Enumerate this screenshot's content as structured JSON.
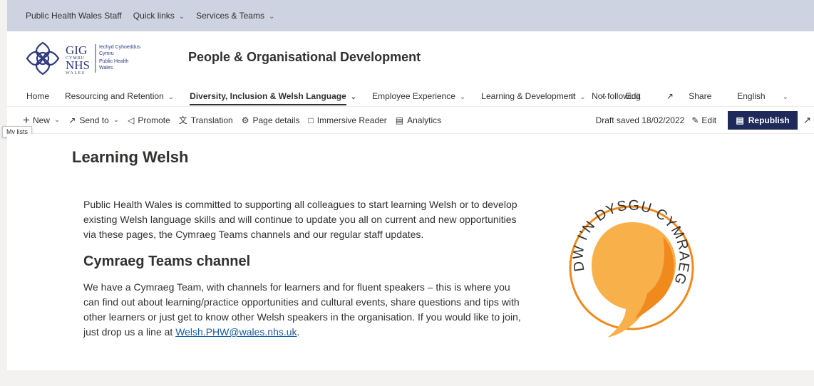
{
  "hub": {
    "items": [
      {
        "label": "Public Health Wales Staff",
        "has_menu": false
      },
      {
        "label": "Quick links",
        "has_menu": true
      },
      {
        "label": "Services & Teams",
        "has_menu": true
      }
    ]
  },
  "site": {
    "logo_lines": [
      "Iechyd Cyhoeddus",
      "Cymru",
      "Public Health",
      "Wales"
    ],
    "logo_marks": [
      "GIG",
      "CYMRU",
      "NHS",
      "WALES"
    ],
    "title": "People & Organisational Development"
  },
  "nav": {
    "items": [
      {
        "label": "Home",
        "has_menu": false,
        "active": false
      },
      {
        "label": "Resourcing and Retention",
        "has_menu": true,
        "active": false
      },
      {
        "label": "Diversity, Inclusion & Welsh Language",
        "has_menu": true,
        "active": true
      },
      {
        "label": "Employee Experience",
        "has_menu": true,
        "active": false
      },
      {
        "label": "Learning & Development",
        "has_menu": true,
        "active": false
      },
      {
        "label": "···",
        "has_menu": false,
        "active": false
      },
      {
        "label": "Edit",
        "has_menu": false,
        "active": false
      }
    ],
    "not_following": "Not following",
    "share": "Share",
    "language": "English"
  },
  "cmdbar": {
    "new": "New",
    "send_to": "Send to",
    "promote": "Promote",
    "translation": "Translation",
    "page_details": "Page details",
    "immersive_reader": "Immersive Reader",
    "analytics": "Analytics",
    "draft_saved": "Draft saved 18/02/2022",
    "edit": "Edit",
    "republish": "Republish"
  },
  "tooltip": "My lists",
  "content": {
    "heading": "Learning Welsh",
    "intro": "Public Health Wales is committed to supporting all colleagues to start learning Welsh or to develop existing Welsh language skills and will continue to update you all on current and new opportunities via these pages, the Cymraeg Teams channels and our regular staff updates.",
    "subheading": "Cymraeg Teams channel",
    "body_before_link": "We have a Cymraeg Team, with channels for learners and for fluent speakers – this is where you can find out about learning/practice opportunities and cultural events, share questions and tips with other learners or just get to know other Welsh speakers in the organisation. If you would like to join, just drop us a line at ",
    "email_link": "Welsh.PHW@wales.nhs.uk",
    "body_after_link": ".",
    "badge_text": "DW I'N DYSGU CYMRAEG"
  },
  "colors": {
    "hub_bg": "#cdd3e0",
    "republish_bg": "#1e2a5a",
    "link": "#1a5ba6",
    "badge_orange": "#f08a1c",
    "badge_light": "#f8b14a",
    "logo_blue": "#2e3a7c"
  }
}
